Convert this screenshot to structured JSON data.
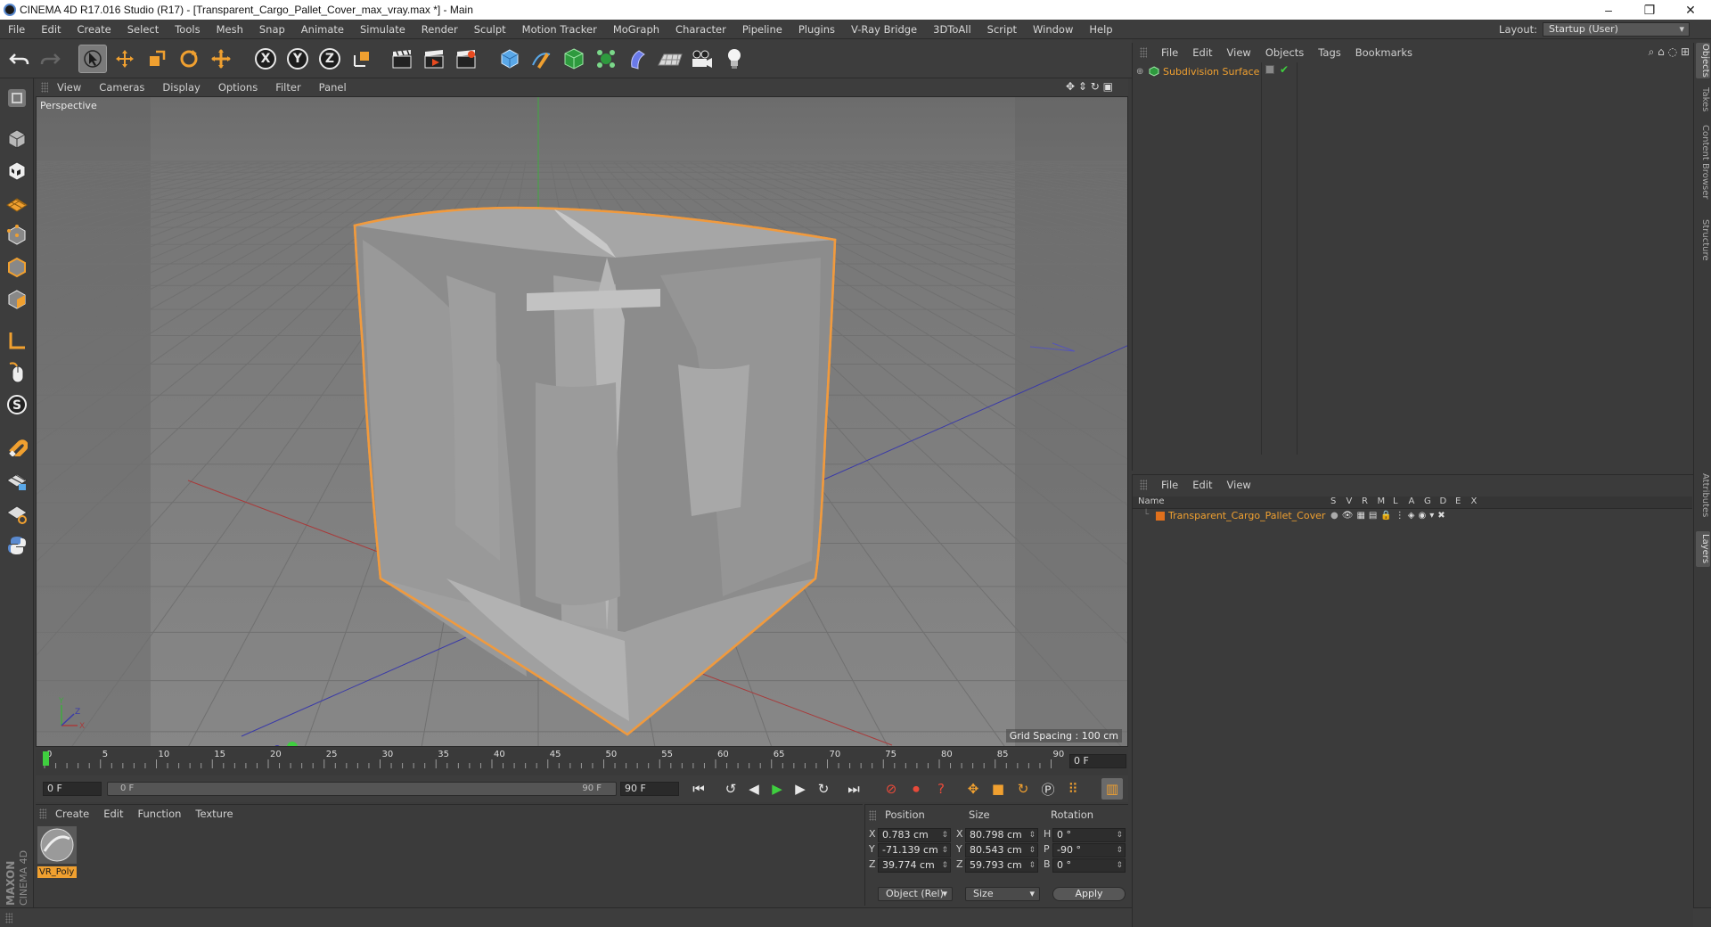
{
  "window": {
    "title": "CINEMA 4D R17.016 Studio (R17) - [Transparent_Cargo_Pallet_Cover_max_vray.max *] - Main",
    "minimize": "–",
    "maximize": "❐",
    "close": "✕"
  },
  "menu": [
    "File",
    "Edit",
    "Create",
    "Select",
    "Tools",
    "Mesh",
    "Snap",
    "Animate",
    "Simulate",
    "Render",
    "Sculpt",
    "Motion Tracker",
    "MoGraph",
    "Character",
    "Pipeline",
    "Plugins",
    "V-Ray Bridge",
    "3DToAll",
    "Script",
    "Window",
    "Help"
  ],
  "layout": {
    "label": "Layout:",
    "value": "Startup (User)"
  },
  "toolbar": {
    "axis_x": "X",
    "axis_y": "Y",
    "axis_z": "Z"
  },
  "viewport": {
    "menu": [
      "View",
      "Cameras",
      "Display",
      "Options",
      "Filter",
      "Panel"
    ],
    "label": "Perspective",
    "grid_spacing": "Grid Spacing : 100 cm"
  },
  "timeline": {
    "ticks": [
      "0",
      "5",
      "10",
      "15",
      "20",
      "25",
      "30",
      "35",
      "40",
      "45",
      "50",
      "55",
      "60",
      "65",
      "70",
      "75",
      "80",
      "85",
      "90"
    ],
    "current_frame_right": "0 F",
    "start_frame": "0 F",
    "range_start": "0 F",
    "range_end": "90 F",
    "end_frame": "90 F"
  },
  "materials": {
    "menu": [
      "Create",
      "Edit",
      "Function",
      "Texture"
    ],
    "items": [
      {
        "name": "VR_Poly"
      }
    ]
  },
  "coordinates": {
    "headers": {
      "position": "Position",
      "size": "Size",
      "rotation": "Rotation"
    },
    "rows": [
      {
        "axis": "X",
        "position": "0.783 cm",
        "size_axis": "X",
        "size": "80.798 cm",
        "rot_axis": "H",
        "rotation": "0 °"
      },
      {
        "axis": "Y",
        "position": "-71.139 cm",
        "size_axis": "Y",
        "size": "80.543 cm",
        "rot_axis": "P",
        "rotation": "-90 °"
      },
      {
        "axis": "Z",
        "position": "39.774 cm",
        "size_axis": "Z",
        "size": "59.793 cm",
        "rot_axis": "B",
        "rotation": "0 °"
      }
    ],
    "mode": "Object (Rel)",
    "size_mode": "Size",
    "apply": "Apply"
  },
  "object_manager": {
    "menu": [
      "File",
      "Edit",
      "View",
      "Objects",
      "Tags",
      "Bookmarks"
    ],
    "objects": [
      {
        "name": "Subdivision Surface"
      }
    ]
  },
  "layer_manager": {
    "menu": [
      "File",
      "Edit",
      "View"
    ],
    "columns": [
      "Name",
      "S",
      "V",
      "R",
      "M",
      "L",
      "A",
      "G",
      "D",
      "E",
      "X"
    ],
    "layers": [
      {
        "name": "Transparent_Cargo_Pallet_Cover",
        "color": "#e0701c"
      }
    ]
  },
  "side_tabs": [
    "Objects",
    "Takes",
    "Content Browser",
    "Structure",
    "Attributes",
    "Layers"
  ],
  "branding": {
    "maxon": "MAXON",
    "product": "CINEMA 4D"
  },
  "colors": {
    "accent_orange": "#f0a030",
    "selection_outline": "#f09a3e"
  }
}
